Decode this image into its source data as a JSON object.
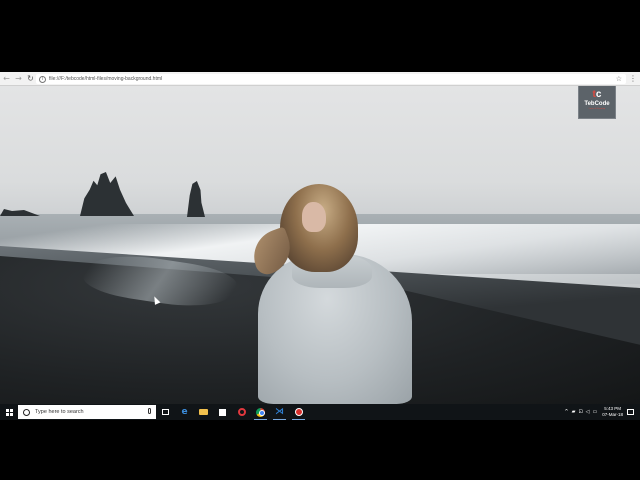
{
  "browser": {
    "back_glyph": "←",
    "forward_glyph": "→",
    "reload_glyph": "↻",
    "info_glyph": "i",
    "url": "file:///F:/tebcode/html-files/moving-background.html",
    "star_glyph": "☆",
    "menu_glyph": "⋮"
  },
  "page": {
    "logo": {
      "mark_left": "t",
      "mark_right": "c",
      "name": "TebCode",
      "tagline": "Learn & Develop"
    }
  },
  "taskbar": {
    "search_placeholder": "Type here to search",
    "edge_glyph": "e",
    "vscode_glyph": "⋊",
    "tray": {
      "chevron_glyph": "^",
      "clock_time": "5:43 PM",
      "clock_date": "07-Mar-18"
    }
  },
  "colors": {
    "accent": "#e0483e",
    "taskbar": "#101417",
    "logo_bg": "#5c6369"
  }
}
